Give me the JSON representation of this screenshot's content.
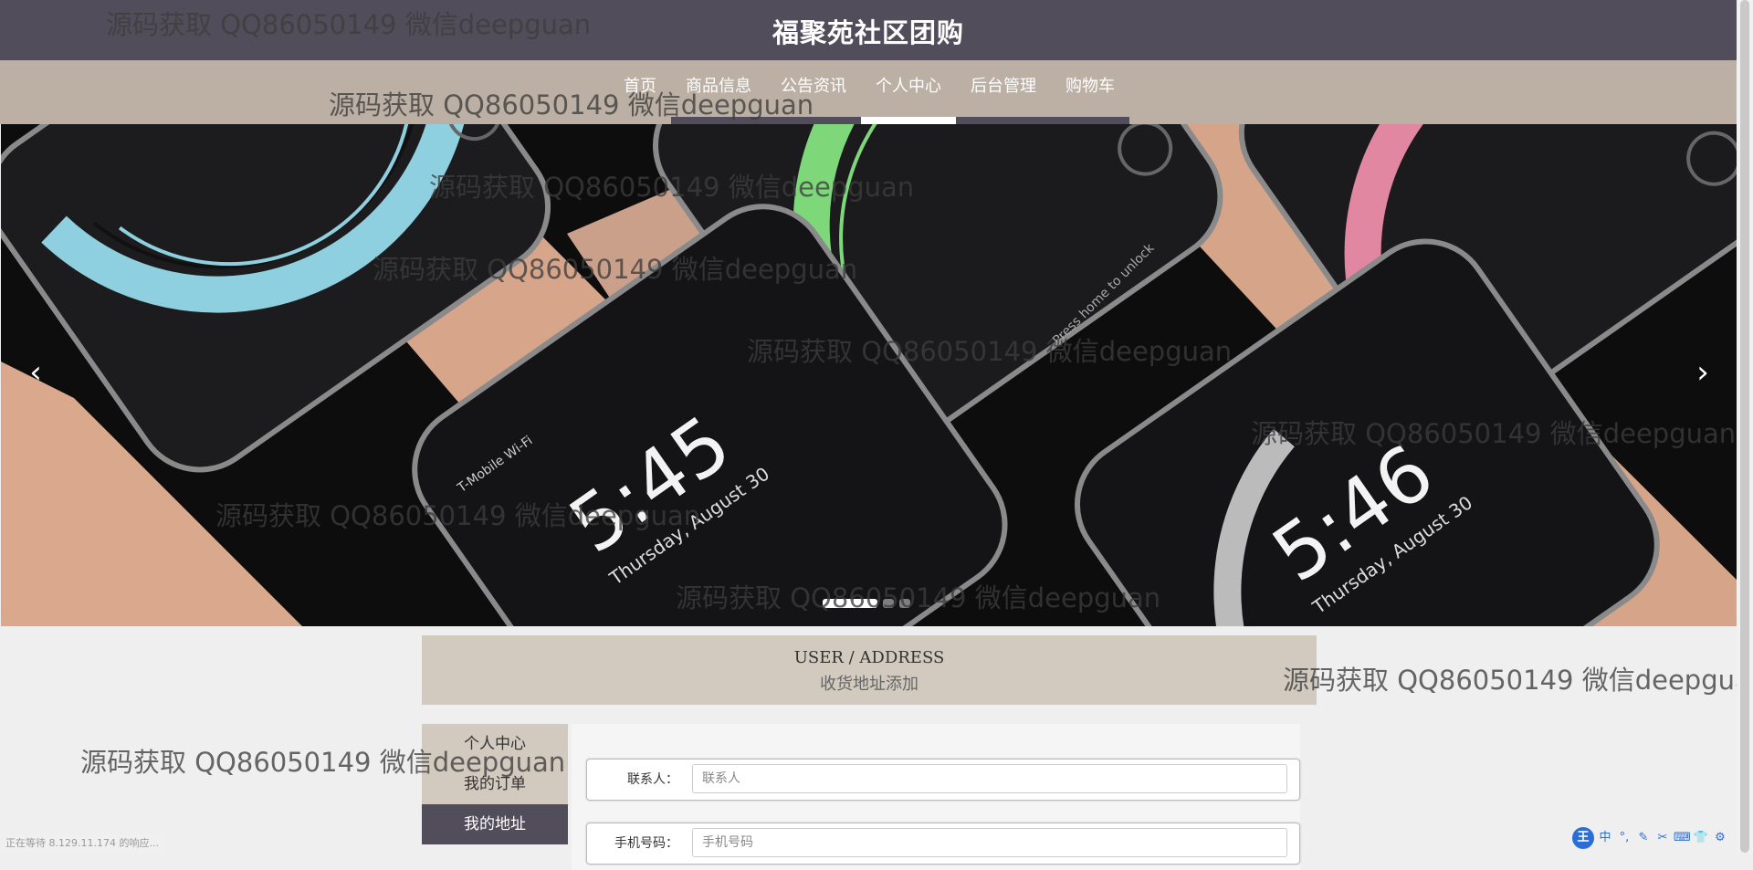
{
  "header": {
    "site_title": "福聚苑社区团购"
  },
  "nav": [
    {
      "label": "首页",
      "active": false
    },
    {
      "label": "商品信息",
      "active": false
    },
    {
      "label": "公告资讯",
      "active": false
    },
    {
      "label": "个人中心",
      "active": true
    },
    {
      "label": "后台管理",
      "active": false
    },
    {
      "label": "购物车",
      "active": false
    }
  ],
  "carousel": {
    "prev_icon": "chevron-left-icon",
    "next_icon": "chevron-right-icon",
    "prev_glyph": "‹",
    "next_glyph": "›",
    "slide_count": 3,
    "active_index": 0,
    "phone_texts": {
      "time_1": "5:45",
      "date_1": "Thursday, August 30",
      "carrier_1": "T-Mobile Wi-Fi",
      "time_2": "5:46",
      "date_2": "Thursday, August 30",
      "unlock": "Press home to unlock"
    }
  },
  "section": {
    "title_en": "USER / ADDRESS",
    "title_zh": "收货地址添加"
  },
  "side_menu": [
    {
      "label": "个人中心",
      "active": false
    },
    {
      "label": "我的订单",
      "active": false
    },
    {
      "label": "我的地址",
      "active": true
    }
  ],
  "form": {
    "contact": {
      "label": "联系人：",
      "placeholder": "联系人",
      "value": ""
    },
    "phone": {
      "label": "手机号码：",
      "placeholder": "手机号码",
      "value": ""
    }
  },
  "watermark_text": "源码获取 QQ86050149 微信deepguan",
  "status_text": "正在等待 8.129.11.174 的响应...",
  "ime": {
    "logo": "王",
    "items": [
      "中",
      "°,",
      "✎",
      "✂",
      "⌨",
      "👕",
      "⚙"
    ]
  },
  "colors": {
    "header_bg": "#524d5a",
    "nav_bg": "#bcb0a5",
    "section_bg": "#d2c9bf",
    "active_bg": "#524d5a"
  }
}
